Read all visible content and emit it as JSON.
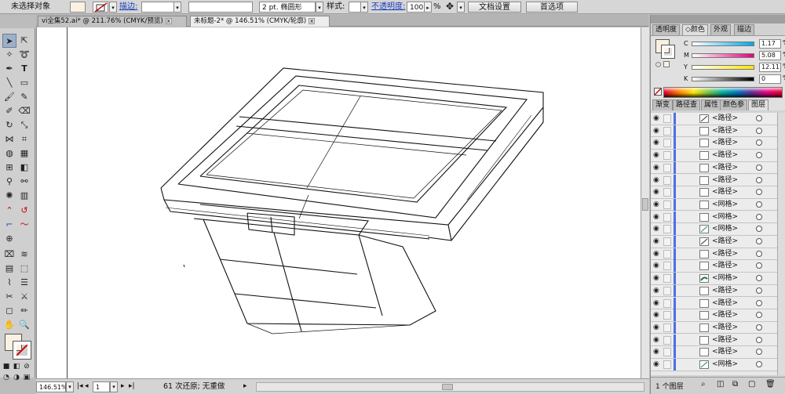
{
  "control_bar": {
    "selection_status": "未选择对象",
    "stroke_label": "描边:",
    "stroke_weight": "",
    "brush_definition": "",
    "stroke_profile": "2 pt. 椭圆形",
    "style_label": "样式:",
    "opacity_label": "不透明度:",
    "opacity_value": "100",
    "opacity_unit": "%",
    "doc_setup_button": "文档设置",
    "preferences_button": "首选项"
  },
  "document_tabs": [
    {
      "label": "vi全集52.ai* @ 211.76% (CMYK/预览)",
      "close": "x",
      "active": false
    },
    {
      "label": "未标题-2* @ 146.51% (CMYK/轮廓)",
      "close": "x",
      "active": true
    }
  ],
  "status_bar": {
    "zoom": "146.51%",
    "artboard_number": "1",
    "history_text": "61 次还原; 无重做"
  },
  "color_panel": {
    "tabs": [
      "透明度",
      "颜色",
      "外观",
      "描边"
    ],
    "active_tab": "颜色",
    "channels": [
      {
        "label": "C",
        "value": "1.17",
        "unit": "%",
        "gradient": [
          "#ffffff",
          "#00a7e8"
        ]
      },
      {
        "label": "M",
        "value": "5.08",
        "unit": "%",
        "gradient": [
          "#ffffff",
          "#e6007e"
        ]
      },
      {
        "label": "Y",
        "value": "12.11",
        "unit": "%",
        "gradient": [
          "#ffffff",
          "#ffe600"
        ]
      },
      {
        "label": "K",
        "value": "0",
        "unit": "%",
        "gradient": [
          "#ffffff",
          "#000000"
        ]
      }
    ],
    "fill_color": "#fbf1e2"
  },
  "layers_panel": {
    "tabs": [
      "渐变",
      "路径查",
      "属性",
      "颜色参",
      "图层"
    ],
    "active_tab": "图层",
    "rows": [
      {
        "name": "<路径>",
        "thumb": "line"
      },
      {
        "name": "<路径>",
        "thumb": "blank"
      },
      {
        "name": "<路径>",
        "thumb": "blank"
      },
      {
        "name": "<路径>",
        "thumb": "blank"
      },
      {
        "name": "<路径>",
        "thumb": "blank"
      },
      {
        "name": "<路径>",
        "thumb": "blank"
      },
      {
        "name": "<路径>",
        "thumb": "blank"
      },
      {
        "name": "<网格>",
        "thumb": "blank"
      },
      {
        "name": "<网格>",
        "thumb": "blank"
      },
      {
        "name": "<网格>",
        "thumb": "mesh"
      },
      {
        "name": "<路径>",
        "thumb": "line"
      },
      {
        "name": "<路径>",
        "thumb": "blank"
      },
      {
        "name": "<路径>",
        "thumb": "blank"
      },
      {
        "name": "<网格>",
        "thumb": "green"
      },
      {
        "name": "<路径>",
        "thumb": "blank"
      },
      {
        "name": "<路径>",
        "thumb": "blank"
      },
      {
        "name": "<路径>",
        "thumb": "blank"
      },
      {
        "name": "<路径>",
        "thumb": "blank"
      },
      {
        "name": "<路径>",
        "thumb": "blank"
      },
      {
        "name": "<路径>",
        "thumb": "blank"
      },
      {
        "name": "<网格>",
        "thumb": "mesh"
      }
    ],
    "footer_label": "1 个图层"
  }
}
